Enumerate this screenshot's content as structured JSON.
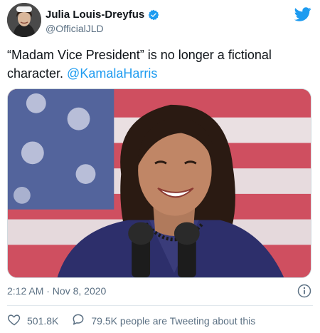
{
  "author": {
    "display_name": "Julia Louis-Dreyfus",
    "handle": "@OfficialJLD",
    "avatar_icon": "avatar",
    "verified_icon": "verified-badge-icon"
  },
  "brand": {
    "logo_icon": "twitter-bird-icon",
    "accent": "#1d9bf0"
  },
  "tweet": {
    "text": "“Madam Vice President” is no longer a fictional character. ",
    "mention": "@KamalaHarris",
    "timestamp": "2:12 AM · Nov 8, 2020"
  },
  "photo": {
    "subject_icon": "photo"
  },
  "actions": {
    "like_count": "501.8K",
    "reply_text": "79.5K people are Tweeting about this"
  }
}
